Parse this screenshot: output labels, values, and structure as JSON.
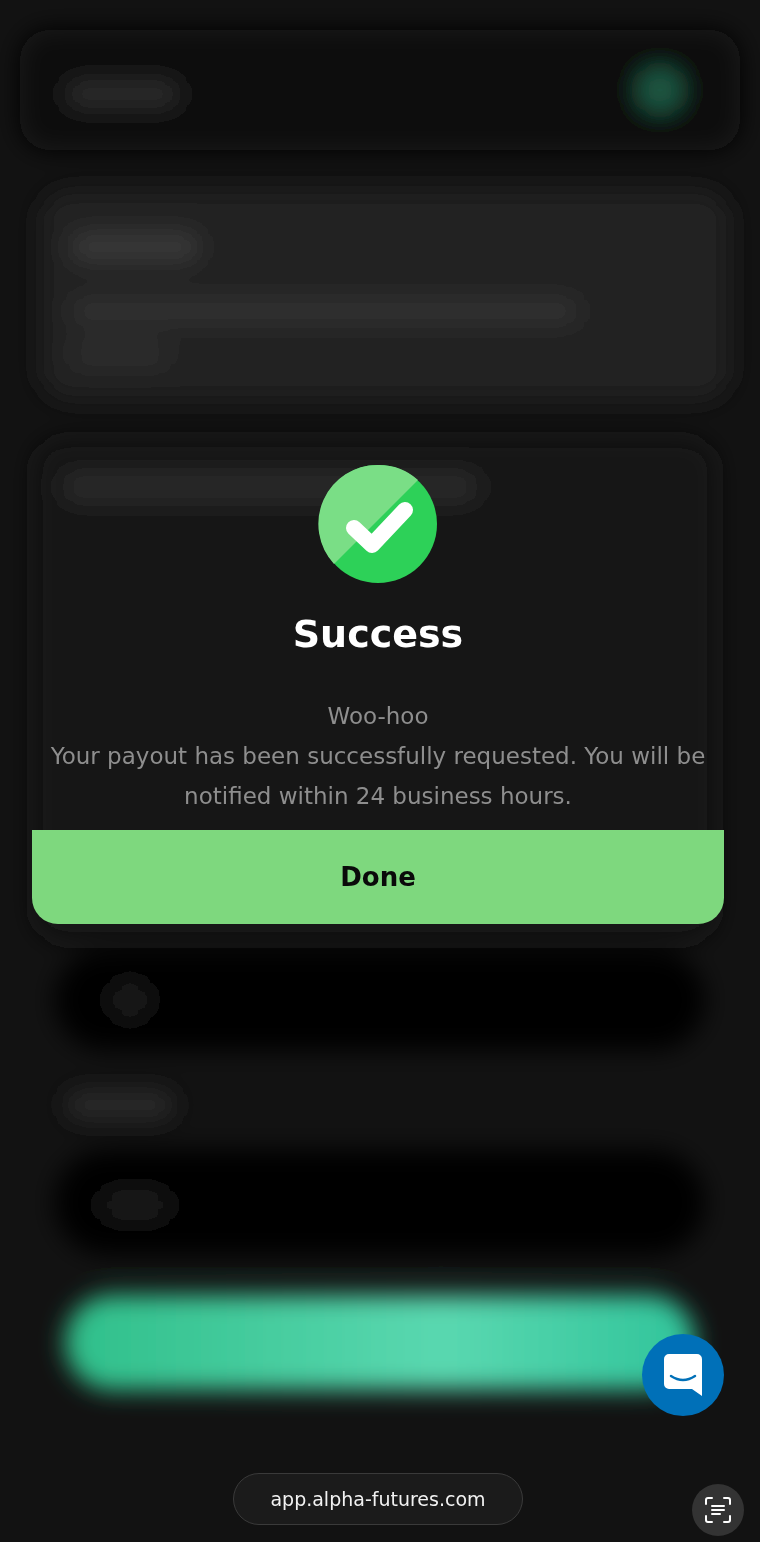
{
  "dialog": {
    "title": "Success",
    "heading": "Woo-hoo",
    "message": "Your payout has been successfully requested. You will be notified within 24 business hours.",
    "button": "Done"
  },
  "address_bar": {
    "url": "app.alpha-futures.com"
  }
}
